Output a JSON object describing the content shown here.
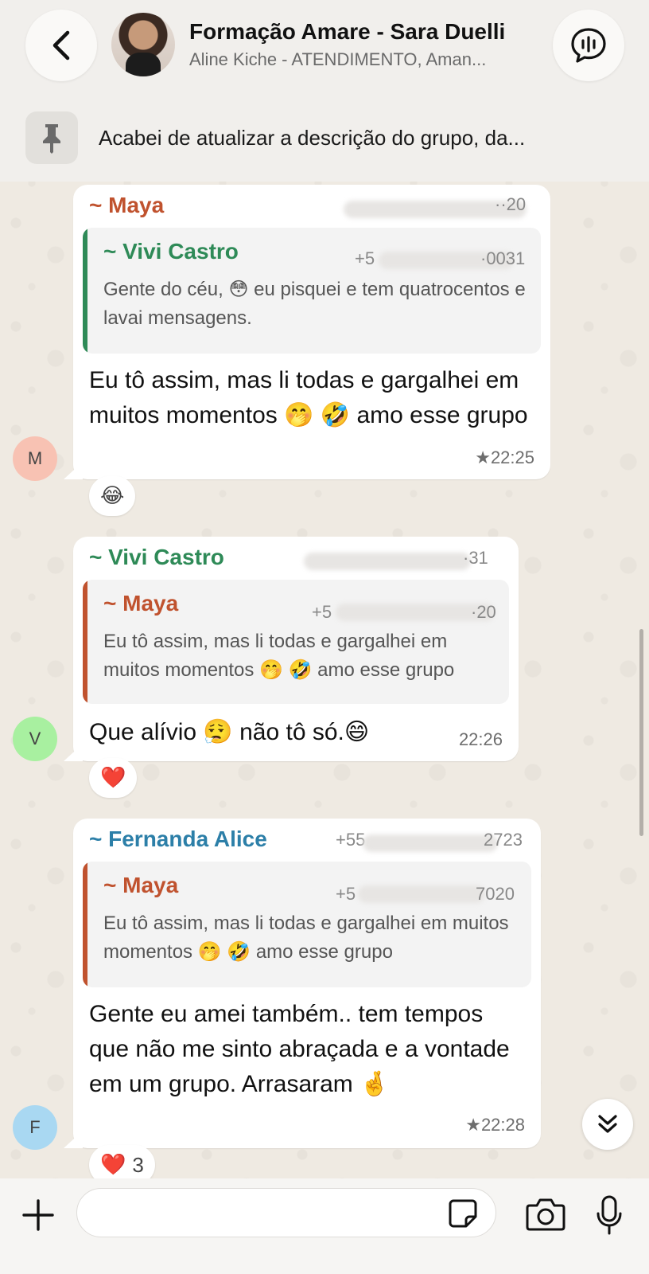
{
  "header": {
    "group_title": "Formação Amare - Sara Duelli",
    "group_subtitle": "Aline Kiche - ATENDIMENTO, Aman...",
    "pinned_text": "Acabei de atualizar a descrição do grupo, da..."
  },
  "messages": [
    {
      "sender": "~ Maya",
      "sender_color": "#c0522e",
      "phone_fragment_right": "··20",
      "quote": {
        "sender": "~ Vivi Castro",
        "sender_color": "#2e8a57",
        "phone_fragment_left": "+5",
        "phone_fragment_right": "·0031",
        "text": "Gente do céu, 😳 eu pisquei e tem quatrocentos e lavai mensagens."
      },
      "text": "Eu tô assim, mas li todas e gargalhei em muitos momentos 🤭 🤣 amo esse grupo",
      "starred": true,
      "time": "22:25",
      "reaction": {
        "emoji": "😂",
        "count": ""
      },
      "avatar_letter": "M",
      "avatar_color": "#f8c2b3"
    },
    {
      "sender": "~ Vivi Castro",
      "sender_color": "#2e8a57",
      "phone_fragment_right": "·31",
      "quote": {
        "sender": "~ Maya",
        "sender_color": "#c0522e",
        "phone_fragment_left": "+5",
        "phone_fragment_right": "·20",
        "text": "Eu tô assim, mas li todas e gargalhei em muitos momentos 🤭 🤣 amo esse grupo"
      },
      "text": "Que alívio 😮‍💨 não tô só.😄",
      "starred": false,
      "time": "22:26",
      "reaction": {
        "emoji": "❤️",
        "count": ""
      },
      "avatar_letter": "V",
      "avatar_color": "#a8f0a0"
    },
    {
      "sender": "~ Fernanda Alice",
      "sender_color": "#2c7fa8",
      "phone_fragment_left": "+55",
      "phone_fragment_right": "2723",
      "quote": {
        "sender": "~ Maya",
        "sender_color": "#c0522e",
        "phone_fragment_left": "+5",
        "phone_fragment_right": "7020",
        "text": "Eu tô assim, mas li todas e gargalhei em muitos momentos 🤭 🤣 amo esse grupo"
      },
      "text": "Gente eu amei também.. tem tempos que não me sinto abraçada e a vontade em um grupo. Arrasaram 🤞",
      "starred": true,
      "time": "22:28",
      "reaction": {
        "emoji": "❤️",
        "count": "3"
      },
      "avatar_letter": "F",
      "avatar_color": "#a9d8f2"
    }
  ],
  "footer": {
    "input_placeholder": ""
  },
  "icons": {
    "back": "chevron-left-icon",
    "audio": "audio-chat-icon",
    "pin": "pin-icon",
    "scroll": "double-chevron-down-icon",
    "plus": "plus-icon",
    "sticker": "sticker-icon",
    "camera": "camera-icon",
    "mic": "microphone-icon"
  }
}
